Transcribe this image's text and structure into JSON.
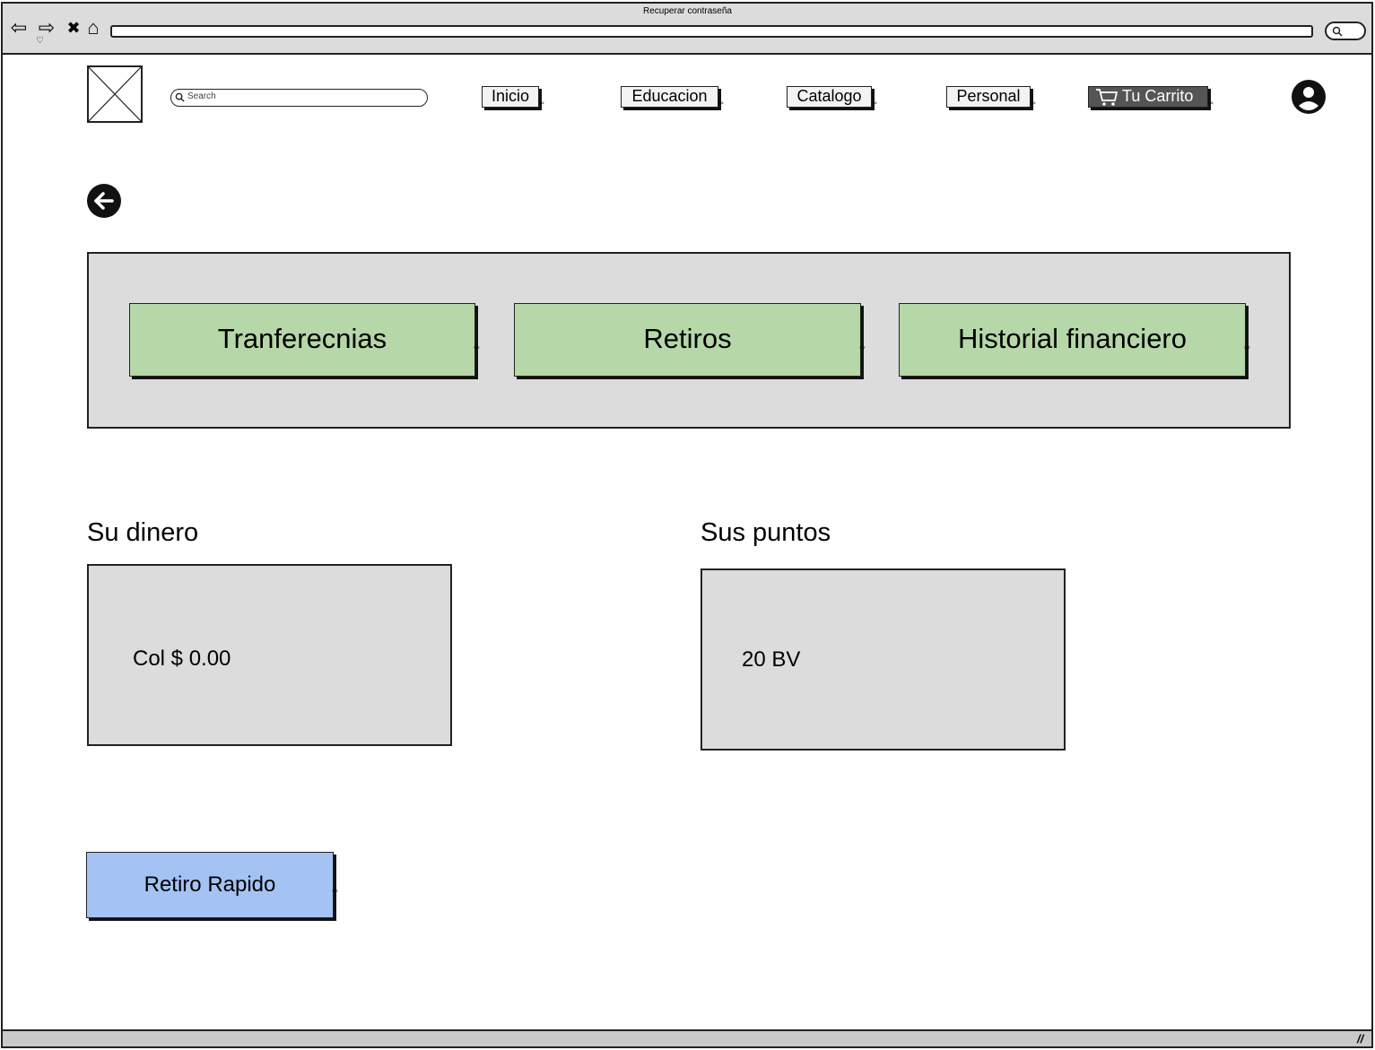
{
  "browser": {
    "title": "Recuperar contraseña",
    "back_glyph": "⇦",
    "forward_glyph": "⇨",
    "stop_glyph": "✖",
    "home_glyph": "⌂",
    "heart_glyph": "♡",
    "resize_glyph": "//"
  },
  "header": {
    "search_placeholder": "Search",
    "nav": {
      "inicio": "Inicio",
      "educacion": "Educacion",
      "catalogo": "Catalogo",
      "personal": "Personal",
      "carrito": "Tu Carrito"
    }
  },
  "actions": {
    "transferencias": "Tranferecnias",
    "retiros": "Retiros",
    "historial": "Historial financiero"
  },
  "balances": {
    "money_title": "Su dinero",
    "money_value": "Col $ 0.00",
    "points_title": "Sus puntos",
    "points_value": "20 BV"
  },
  "quick_withdraw_label": "Retiro Rapido",
  "link_marker": "⇨",
  "icons": {
    "logo": "image-placeholder-icon",
    "search": "search-icon",
    "cart": "cart-icon",
    "user": "user-avatar-icon",
    "back": "arrow-left-circle-icon"
  },
  "colors": {
    "panel": "#dcdcdc",
    "action_green": "#b6d7a8",
    "primary_blue": "#a4c2f4",
    "cart_dark": "#555555"
  }
}
